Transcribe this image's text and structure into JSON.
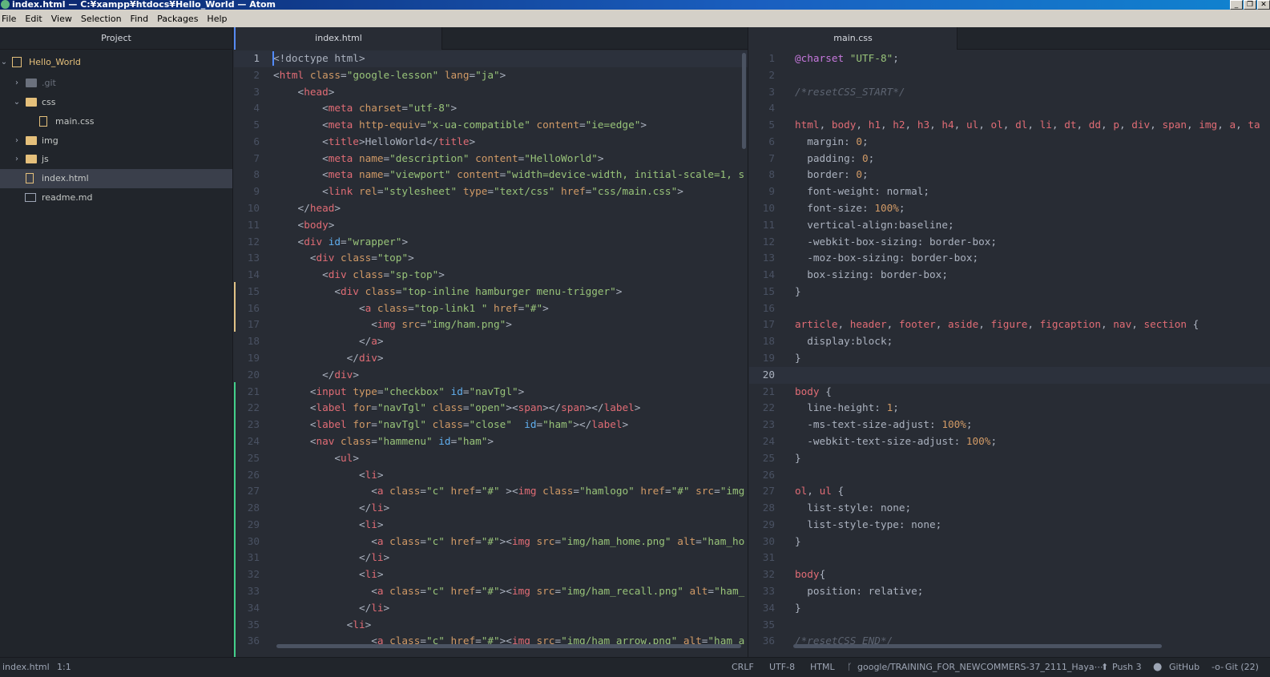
{
  "window": {
    "title": "index.html — C:¥xampp¥htdocs¥Hello_World — Atom"
  },
  "menu": [
    "File",
    "Edit",
    "View",
    "Selection",
    "Find",
    "Packages",
    "Help"
  ],
  "tree": {
    "header": "Project",
    "root": "Hello_World",
    "items": [
      ".git",
      "css",
      "main.css",
      "img",
      "js",
      "index.html",
      "readme.md"
    ]
  },
  "tabs": {
    "left": "index.html",
    "right": "main.css"
  },
  "left_code": [
    [
      [
        "p",
        "<!doctype html>"
      ]
    ],
    [
      [
        "p",
        "<"
      ],
      [
        "t",
        "html"
      ],
      [
        "a",
        " class"
      ],
      [
        "p",
        "="
      ],
      [
        "s",
        "\"google-lesson\""
      ],
      [
        "a",
        " lang"
      ],
      [
        "p",
        "="
      ],
      [
        "s",
        "\"ja\""
      ],
      [
        "p",
        ">"
      ]
    ],
    [
      [
        "p",
        "    <"
      ],
      [
        "t",
        "head"
      ],
      [
        "p",
        ">"
      ]
    ],
    [
      [
        "p",
        "        <"
      ],
      [
        "t",
        "meta"
      ],
      [
        "a",
        " charset"
      ],
      [
        "p",
        "="
      ],
      [
        "s",
        "\"utf-8\""
      ],
      [
        "p",
        ">"
      ]
    ],
    [
      [
        "p",
        "        <"
      ],
      [
        "t",
        "meta"
      ],
      [
        "a",
        " http-equiv"
      ],
      [
        "p",
        "="
      ],
      [
        "s",
        "\"x-ua-compatible\""
      ],
      [
        "a",
        " content"
      ],
      [
        "p",
        "="
      ],
      [
        "s",
        "\"ie=edge\""
      ],
      [
        "p",
        ">"
      ]
    ],
    [
      [
        "p",
        "        <"
      ],
      [
        "t",
        "title"
      ],
      [
        "p",
        ">"
      ],
      [
        "x",
        "HelloWorld"
      ],
      [
        "p",
        "</"
      ],
      [
        "t",
        "title"
      ],
      [
        "p",
        ">"
      ]
    ],
    [
      [
        "p",
        "        <"
      ],
      [
        "t",
        "meta"
      ],
      [
        "a",
        " name"
      ],
      [
        "p",
        "="
      ],
      [
        "s",
        "\"description\""
      ],
      [
        "a",
        " content"
      ],
      [
        "p",
        "="
      ],
      [
        "s",
        "\"HelloWorld\""
      ],
      [
        "p",
        ">"
      ]
    ],
    [
      [
        "p",
        "        <"
      ],
      [
        "t",
        "meta"
      ],
      [
        "a",
        " name"
      ],
      [
        "p",
        "="
      ],
      [
        "s",
        "\"viewport\""
      ],
      [
        "a",
        " content"
      ],
      [
        "p",
        "="
      ],
      [
        "s",
        "\"width=device-width, initial-scale=1, s"
      ]
    ],
    [
      [
        "p",
        "        <"
      ],
      [
        "t",
        "link"
      ],
      [
        "a",
        " rel"
      ],
      [
        "p",
        "="
      ],
      [
        "s",
        "\"stylesheet\""
      ],
      [
        "a",
        " type"
      ],
      [
        "p",
        "="
      ],
      [
        "s",
        "\"text/css\""
      ],
      [
        "a",
        " href"
      ],
      [
        "p",
        "="
      ],
      [
        "s",
        "\"css/main.css\""
      ],
      [
        "p",
        ">"
      ]
    ],
    [
      [
        "p",
        "    </"
      ],
      [
        "t",
        "head"
      ],
      [
        "p",
        ">"
      ]
    ],
    [
      [
        "p",
        "    <"
      ],
      [
        "t",
        "body"
      ],
      [
        "p",
        ">"
      ]
    ],
    [
      [
        "p",
        "    <"
      ],
      [
        "t",
        "div"
      ],
      [
        "i",
        " id"
      ],
      [
        "p",
        "="
      ],
      [
        "s",
        "\"wrapper\""
      ],
      [
        "p",
        ">"
      ]
    ],
    [
      [
        "p",
        "      <"
      ],
      [
        "t",
        "div"
      ],
      [
        "a",
        " class"
      ],
      [
        "p",
        "="
      ],
      [
        "s",
        "\"top\""
      ],
      [
        "p",
        ">"
      ]
    ],
    [
      [
        "p",
        "        <"
      ],
      [
        "t",
        "div"
      ],
      [
        "a",
        " class"
      ],
      [
        "p",
        "="
      ],
      [
        "s",
        "\"sp-top\""
      ],
      [
        "p",
        ">"
      ]
    ],
    [
      [
        "p",
        "          <"
      ],
      [
        "t",
        "div"
      ],
      [
        "a",
        " class"
      ],
      [
        "p",
        "="
      ],
      [
        "s",
        "\"top-inline hamburger menu-trigger\""
      ],
      [
        "p",
        ">"
      ]
    ],
    [
      [
        "p",
        "              <"
      ],
      [
        "t",
        "a"
      ],
      [
        "a",
        " class"
      ],
      [
        "p",
        "="
      ],
      [
        "s",
        "\"top-link1 \""
      ],
      [
        "a",
        " href"
      ],
      [
        "p",
        "="
      ],
      [
        "s",
        "\"#\""
      ],
      [
        "p",
        ">"
      ]
    ],
    [
      [
        "p",
        "                <"
      ],
      [
        "t",
        "img"
      ],
      [
        "a",
        " src"
      ],
      [
        "p",
        "="
      ],
      [
        "s",
        "\"img/ham.png\""
      ],
      [
        "p",
        ">"
      ]
    ],
    [
      [
        "p",
        "              </"
      ],
      [
        "t",
        "a"
      ],
      [
        "p",
        ">"
      ]
    ],
    [
      [
        "p",
        "            </"
      ],
      [
        "t",
        "div"
      ],
      [
        "p",
        ">"
      ]
    ],
    [
      [
        "p",
        "        </"
      ],
      [
        "t",
        "div"
      ],
      [
        "p",
        ">"
      ]
    ],
    [
      [
        "p",
        "      <"
      ],
      [
        "t",
        "input"
      ],
      [
        "a",
        " type"
      ],
      [
        "p",
        "="
      ],
      [
        "s",
        "\"checkbox\""
      ],
      [
        "i",
        " id"
      ],
      [
        "p",
        "="
      ],
      [
        "s",
        "\"navTgl\""
      ],
      [
        "p",
        ">"
      ]
    ],
    [
      [
        "p",
        "      <"
      ],
      [
        "t",
        "label"
      ],
      [
        "a",
        " for"
      ],
      [
        "p",
        "="
      ],
      [
        "s",
        "\"navTgl\""
      ],
      [
        "a",
        " class"
      ],
      [
        "p",
        "="
      ],
      [
        "s",
        "\"open\""
      ],
      [
        "p",
        "><"
      ],
      [
        "t",
        "span"
      ],
      [
        "p",
        "></"
      ],
      [
        "t",
        "span"
      ],
      [
        "p",
        "></"
      ],
      [
        "t",
        "label"
      ],
      [
        "p",
        ">"
      ]
    ],
    [
      [
        "p",
        "      <"
      ],
      [
        "t",
        "label"
      ],
      [
        "a",
        " for"
      ],
      [
        "p",
        "="
      ],
      [
        "s",
        "\"navTgl\""
      ],
      [
        "a",
        " class"
      ],
      [
        "p",
        "="
      ],
      [
        "s",
        "\"close\""
      ],
      [
        "i",
        "  id"
      ],
      [
        "p",
        "="
      ],
      [
        "s",
        "\"ham\""
      ],
      [
        "p",
        "></"
      ],
      [
        "t",
        "label"
      ],
      [
        "p",
        ">"
      ]
    ],
    [
      [
        "p",
        "      <"
      ],
      [
        "t",
        "nav"
      ],
      [
        "a",
        " class"
      ],
      [
        "p",
        "="
      ],
      [
        "s",
        "\"hammenu\""
      ],
      [
        "i",
        " id"
      ],
      [
        "p",
        "="
      ],
      [
        "s",
        "\"ham\""
      ],
      [
        "p",
        ">"
      ]
    ],
    [
      [
        "p",
        "          <"
      ],
      [
        "t",
        "ul"
      ],
      [
        "p",
        ">"
      ]
    ],
    [
      [
        "p",
        "              <"
      ],
      [
        "t",
        "li"
      ],
      [
        "p",
        ">"
      ]
    ],
    [
      [
        "p",
        "                <"
      ],
      [
        "t",
        "a"
      ],
      [
        "a",
        " class"
      ],
      [
        "p",
        "="
      ],
      [
        "s",
        "\"c\""
      ],
      [
        "a",
        " href"
      ],
      [
        "p",
        "="
      ],
      [
        "s",
        "\"#\""
      ],
      [
        "p",
        " ><"
      ],
      [
        "t",
        "img"
      ],
      [
        "a",
        " class"
      ],
      [
        "p",
        "="
      ],
      [
        "s",
        "\"hamlogo\""
      ],
      [
        "a",
        " href"
      ],
      [
        "p",
        "="
      ],
      [
        "s",
        "\"#\""
      ],
      [
        "a",
        " src"
      ],
      [
        "p",
        "="
      ],
      [
        "s",
        "\"img"
      ]
    ],
    [
      [
        "p",
        "              </"
      ],
      [
        "t",
        "li"
      ],
      [
        "p",
        ">"
      ]
    ],
    [
      [
        "p",
        "              <"
      ],
      [
        "t",
        "li"
      ],
      [
        "p",
        ">"
      ]
    ],
    [
      [
        "p",
        "                <"
      ],
      [
        "t",
        "a"
      ],
      [
        "a",
        " class"
      ],
      [
        "p",
        "="
      ],
      [
        "s",
        "\"c\""
      ],
      [
        "a",
        " href"
      ],
      [
        "p",
        "="
      ],
      [
        "s",
        "\"#\""
      ],
      [
        "p",
        "><"
      ],
      [
        "t",
        "img"
      ],
      [
        "a",
        " src"
      ],
      [
        "p",
        "="
      ],
      [
        "s",
        "\"img/ham_home.png\""
      ],
      [
        "a",
        " alt"
      ],
      [
        "p",
        "="
      ],
      [
        "s",
        "\"ham_ho"
      ]
    ],
    [
      [
        "p",
        "              </"
      ],
      [
        "t",
        "li"
      ],
      [
        "p",
        ">"
      ]
    ],
    [
      [
        "p",
        "              <"
      ],
      [
        "t",
        "li"
      ],
      [
        "p",
        ">"
      ]
    ],
    [
      [
        "p",
        "                <"
      ],
      [
        "t",
        "a"
      ],
      [
        "a",
        " class"
      ],
      [
        "p",
        "="
      ],
      [
        "s",
        "\"c\""
      ],
      [
        "a",
        " href"
      ],
      [
        "p",
        "="
      ],
      [
        "s",
        "\"#\""
      ],
      [
        "p",
        "><"
      ],
      [
        "t",
        "img"
      ],
      [
        "a",
        " src"
      ],
      [
        "p",
        "="
      ],
      [
        "s",
        "\"img/ham_recall.png\""
      ],
      [
        "a",
        " alt"
      ],
      [
        "p",
        "="
      ],
      [
        "s",
        "\"ham_"
      ]
    ],
    [
      [
        "p",
        "              </"
      ],
      [
        "t",
        "li"
      ],
      [
        "p",
        ">"
      ]
    ],
    [
      [
        "p",
        "            <"
      ],
      [
        "t",
        "li"
      ],
      [
        "p",
        ">"
      ]
    ],
    [
      [
        "p",
        "                <"
      ],
      [
        "t",
        "a"
      ],
      [
        "a",
        " class"
      ],
      [
        "p",
        "="
      ],
      [
        "s",
        "\"c\""
      ],
      [
        "a",
        " href"
      ],
      [
        "p",
        "="
      ],
      [
        "s",
        "\"#\""
      ],
      [
        "p",
        "><"
      ],
      [
        "t",
        "img"
      ],
      [
        "a",
        " src"
      ],
      [
        "p",
        "="
      ],
      [
        "s",
        "\"img/ham_arrow.png\""
      ],
      [
        "a",
        " alt"
      ],
      [
        "p",
        "="
      ],
      [
        "s",
        "\"ham_a"
      ]
    ]
  ],
  "right_code": [
    [
      [
        "k",
        "@charset"
      ],
      [
        "s",
        " \"UTF-8\""
      ],
      [
        "p",
        ";"
      ]
    ],
    [],
    [
      [
        "c",
        "/*resetCSS_START*/"
      ]
    ],
    [],
    [
      [
        "l",
        "html"
      ],
      [
        "p",
        ", "
      ],
      [
        "l",
        "body"
      ],
      [
        "p",
        ", "
      ],
      [
        "l",
        "h1"
      ],
      [
        "p",
        ", "
      ],
      [
        "l",
        "h2"
      ],
      [
        "p",
        ", "
      ],
      [
        "l",
        "h3"
      ],
      [
        "p",
        ", "
      ],
      [
        "l",
        "h4"
      ],
      [
        "p",
        ", "
      ],
      [
        "l",
        "ul"
      ],
      [
        "p",
        ", "
      ],
      [
        "l",
        "ol"
      ],
      [
        "p",
        ", "
      ],
      [
        "l",
        "dl"
      ],
      [
        "p",
        ", "
      ],
      [
        "l",
        "li"
      ],
      [
        "p",
        ", "
      ],
      [
        "l",
        "dt"
      ],
      [
        "p",
        ", "
      ],
      [
        "l",
        "dd"
      ],
      [
        "p",
        ", "
      ],
      [
        "l",
        "p"
      ],
      [
        "p",
        ", "
      ],
      [
        "l",
        "div"
      ],
      [
        "p",
        ", "
      ],
      [
        "l",
        "span"
      ],
      [
        "p",
        ", "
      ],
      [
        "l",
        "img"
      ],
      [
        "p",
        ", "
      ],
      [
        "l",
        "a"
      ],
      [
        "p",
        ", "
      ],
      [
        "l",
        "ta"
      ]
    ],
    [
      [
        "x",
        "  margin: "
      ],
      [
        "n",
        "0"
      ],
      [
        "p",
        ";"
      ]
    ],
    [
      [
        "x",
        "  padding: "
      ],
      [
        "n",
        "0"
      ],
      [
        "p",
        ";"
      ]
    ],
    [
      [
        "x",
        "  border: "
      ],
      [
        "n",
        "0"
      ],
      [
        "p",
        ";"
      ]
    ],
    [
      [
        "x",
        "  font-weight: normal;"
      ]
    ],
    [
      [
        "x",
        "  font-size: "
      ],
      [
        "n",
        "100%"
      ],
      [
        "p",
        ";"
      ]
    ],
    [
      [
        "x",
        "  vertical-align:baseline;"
      ]
    ],
    [
      [
        "x",
        "  -webkit-box-sizing: border-box;"
      ]
    ],
    [
      [
        "x",
        "  -moz-box-sizing: border-box;"
      ]
    ],
    [
      [
        "x",
        "  box-sizing: border-box;"
      ]
    ],
    [
      [
        "p",
        "}"
      ]
    ],
    [],
    [
      [
        "l",
        "article"
      ],
      [
        "p",
        ", "
      ],
      [
        "l",
        "header"
      ],
      [
        "p",
        ", "
      ],
      [
        "l",
        "footer"
      ],
      [
        "p",
        ", "
      ],
      [
        "l",
        "aside"
      ],
      [
        "p",
        ", "
      ],
      [
        "l",
        "figure"
      ],
      [
        "p",
        ", "
      ],
      [
        "l",
        "figcaption"
      ],
      [
        "p",
        ", "
      ],
      [
        "l",
        "nav"
      ],
      [
        "p",
        ", "
      ],
      [
        "l",
        "section"
      ],
      [
        "p",
        " {"
      ]
    ],
    [
      [
        "x",
        "  display:block;"
      ]
    ],
    [
      [
        "p",
        "}"
      ]
    ],
    [],
    [
      [
        "l",
        "body"
      ],
      [
        "p",
        " {"
      ]
    ],
    [
      [
        "x",
        "  line-height: "
      ],
      [
        "n",
        "1"
      ],
      [
        "p",
        ";"
      ]
    ],
    [
      [
        "x",
        "  -ms-text-size-adjust: "
      ],
      [
        "n",
        "100%"
      ],
      [
        "p",
        ";"
      ]
    ],
    [
      [
        "x",
        "  -webkit-text-size-adjust: "
      ],
      [
        "n",
        "100%"
      ],
      [
        "p",
        ";"
      ]
    ],
    [
      [
        "p",
        "}"
      ]
    ],
    [],
    [
      [
        "l",
        "ol"
      ],
      [
        "p",
        ", "
      ],
      [
        "l",
        "ul"
      ],
      [
        "p",
        " {"
      ]
    ],
    [
      [
        "x",
        "  list-style: none;"
      ]
    ],
    [
      [
        "x",
        "  list-style-type: none;"
      ]
    ],
    [
      [
        "p",
        "}"
      ]
    ],
    [],
    [
      [
        "l",
        "body"
      ],
      [
        "p",
        "{"
      ]
    ],
    [
      [
        "x",
        "  position: relative;"
      ]
    ],
    [
      [
        "p",
        "}"
      ]
    ],
    [],
    [
      [
        "c",
        "/*resetCSS_END*/"
      ]
    ]
  ],
  "status": {
    "file": "index.html",
    "cursor": "1:1",
    "line_ending": "CRLF",
    "encoding": "UTF-8",
    "grammar": "HTML",
    "branch": "google/TRAINING_FOR_NEWCOMMERS-37_2111_Haya⋯",
    "push": "Push 3",
    "github": "GitHub",
    "git": "Git (22)"
  },
  "colors": {
    "accent": "#568af2",
    "git_added": "#43d08a",
    "git_modified": "#e0c285"
  }
}
